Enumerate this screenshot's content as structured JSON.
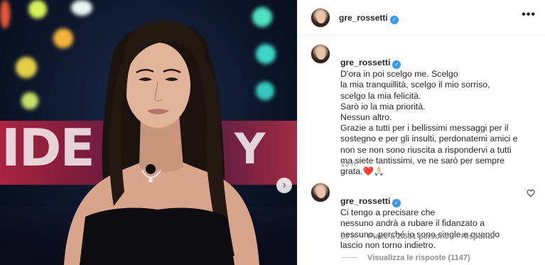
{
  "post": {
    "username": "gre_rossetti",
    "verified_mark": "✓",
    "more_icon": "more-horizontal-icon",
    "photo_next_icon": "chevron-right-icon",
    "photo_next_glyph": "›",
    "photo_stage_text": "IDE"
  },
  "caption": {
    "username": "gre_rossetti",
    "text": "D'ora in poi scelgo me. Scelgo\nla mia tranquillità, scelgo il mio sorriso,\nscelgo la mia felicità.\nSarò io la mia priorità.\nNessun altro.\nGrazie a tutti per i bellissimi messaggi per il\nsostegno e per gli insulti, perdonatemi amici e\nnon se non sono riuscita a rispondervi a tutti\nma siete tantissimi, ve ne sarò per sempre\ngrata.❤️🙏🏻",
    "time": "13 h"
  },
  "reply_comment": {
    "username": "gre_rossetti",
    "text": "Ci tengo a precisare che\nnessuno andrà a rubare il fidanzato a\nnessuno, perché io sono single e quando\nlascio non torno indietro.",
    "time": "13 h",
    "likes": "Piace a 2.501 persone",
    "reply_label": "Rispondi",
    "view_replies": "Visualizza le risposte (1147)",
    "like_icon": "heart-outline-icon"
  },
  "colors": {
    "verified_blue": "#3897f0",
    "meta_gray": "#8e8e8e",
    "text": "#262626"
  }
}
